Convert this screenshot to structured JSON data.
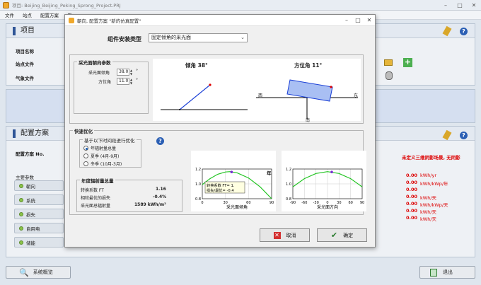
{
  "app": {
    "title": "项目: Beijing_Beijing_Peking_Sprong_Project.PRJ",
    "menu": [
      "文件",
      "站点",
      "配置方案",
      "用"
    ]
  },
  "background": {
    "project_section": "项目",
    "project_name_label": "项目名称",
    "site_file_label": "站点文件",
    "weather_file_label": "气象文件",
    "config_section": "配置方案",
    "config_no_label": "配置方案 No.",
    "main_params_label": "主要参数",
    "side_buttons": [
      "朝向",
      "系统",
      "损失",
      "自用电",
      "储能"
    ],
    "undefined_shading": "未定义三维阴影场景, 无阴影",
    "results": [
      {
        "value": "0.00",
        "unit": "kWh/yr"
      },
      {
        "value": "0.00",
        "unit": "kWh/kWp/年"
      },
      {
        "value": "0.00",
        "unit": ""
      },
      {
        "value": "0.00",
        "unit": "kWh/天"
      },
      {
        "value": "0.00",
        "unit": "kWh/kWp/天"
      },
      {
        "value": "0.00",
        "unit": "kWh/天"
      },
      {
        "value": "0.00",
        "unit": "kWh/天"
      }
    ],
    "system_overview_btn": "系统概览",
    "exit_btn": "退出"
  },
  "dialog": {
    "title": "朝向, 配置方案 \"新的仿真配置\"",
    "component_type_label": "组件安装类型",
    "component_type_value": "固定倾角的采光面",
    "orientation_params": {
      "title": "采光面朝向参数",
      "tilt_label": "采光面倾角",
      "tilt_value": "38.0",
      "azimuth_label": "方位角",
      "azimuth_value": "11.0",
      "unit": "°"
    },
    "tilt_diagram_label": "倾角 38°",
    "azimuth_diagram_label": "方位角 11°",
    "compass": {
      "west": "西",
      "east": "东",
      "south": "南"
    },
    "quick_opt": {
      "title": "快速优化",
      "subgroup_title": "基于以下时间段进行优化",
      "options": [
        "年辐射量总量",
        "夏季 (4月-9月)",
        "冬季 (10月-3月)"
      ],
      "selected": 0
    },
    "annual_irr": {
      "title": "年度辐射量总量",
      "rows": [
        {
          "label": "转换系数 FT",
          "value": "1.16"
        },
        {
          "label": "相较最优的损失",
          "value": "-0.4%"
        },
        {
          "label": "采光面总辐射量",
          "value": "1589 kWh/m²"
        }
      ]
    },
    "cancel_btn": "取消",
    "ok_btn": "确定"
  },
  "chart_data": [
    {
      "type": "line",
      "xlabel": "采光面倾角",
      "x_ticks": [
        "0",
        "30",
        "60",
        "90"
      ],
      "y_ticks": [
        "0.8",
        "1.0",
        "1.2"
      ],
      "xlim": [
        0,
        90
      ],
      "ylim": [
        0.8,
        1.2
      ],
      "corner_label": "年",
      "tooltip": [
        "转换系数 FT= 1.",
        "损失/最优= -0.4"
      ],
      "series": [
        {
          "x": [
            0,
            10,
            20,
            30,
            36,
            45,
            60,
            75,
            90
          ],
          "y": [
            0.99,
            1.07,
            1.13,
            1.16,
            1.165,
            1.15,
            1.08,
            0.96,
            0.8
          ]
        }
      ],
      "marker": {
        "x": 38,
        "y": 1.16
      }
    },
    {
      "type": "line",
      "xlabel": "采光面方向",
      "x_ticks": [
        "-90",
        "-60",
        "-30",
        "0",
        "30",
        "60",
        "90"
      ],
      "y_ticks": [
        "0.8",
        "1.0",
        "1.2"
      ],
      "xlim": [
        -90,
        90
      ],
      "ylim": [
        0.8,
        1.2
      ],
      "series": [
        {
          "x": [
            -90,
            -60,
            -30,
            0,
            30,
            60,
            90
          ],
          "y": [
            0.96,
            1.07,
            1.14,
            1.165,
            1.14,
            1.07,
            0.96
          ]
        }
      ],
      "marker": {
        "x": 11,
        "y": 1.16
      }
    }
  ]
}
